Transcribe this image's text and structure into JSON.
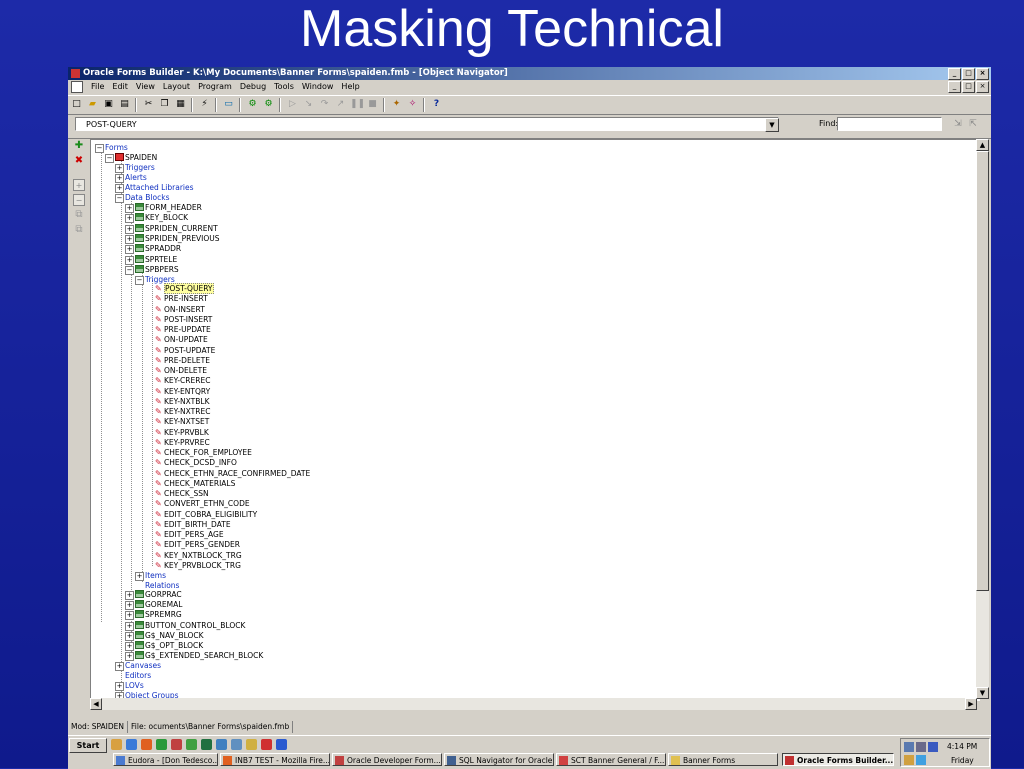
{
  "slide": {
    "title": "Masking Technical"
  },
  "window": {
    "title": "Oracle Forms Builder - K:\\My Documents\\Banner Forms\\spaiden.fmb - [Object Navigator]",
    "controls": [
      "_",
      "□",
      "×"
    ]
  },
  "menu": [
    "File",
    "Edit",
    "View",
    "Layout",
    "Program",
    "Debug",
    "Tools",
    "Window",
    "Help"
  ],
  "findbar": {
    "current": "POST-QUERY",
    "find_label": "Find:",
    "find_value": ""
  },
  "tree": {
    "forms": "Forms",
    "form": "SPAIDEN",
    "triggers": "Triggers",
    "alerts": "Alerts",
    "attached_libraries": "Attached Libraries",
    "data_blocks": "Data Blocks",
    "blocks_before": [
      "FORM_HEADER",
      "KEY_BLOCK",
      "SPRIDEN_CURRENT",
      "SPRIDEN_PREVIOUS",
      "SPRADDR",
      "SPRTELE"
    ],
    "open_block": "SPBPERS",
    "open_block_triggers": "Triggers",
    "block_triggers": [
      "POST-QUERY",
      "PRE-INSERT",
      "ON-INSERT",
      "POST-INSERT",
      "PRE-UPDATE",
      "ON-UPDATE",
      "POST-UPDATE",
      "PRE-DELETE",
      "ON-DELETE",
      "KEY-CREREC",
      "KEY-ENTQRY",
      "KEY-NXTBLK",
      "KEY-NXTREC",
      "KEY-NXTSET",
      "KEY-PRVBLK",
      "KEY-PRVREC",
      "CHECK_FOR_EMPLOYEE",
      "CHECK_DCSD_INFO",
      "CHECK_ETHN_RACE_CONFIRMED_DATE",
      "CHECK_MATERIALS",
      "CHECK_SSN",
      "CONVERT_ETHN_CODE",
      "EDIT_COBRA_ELIGIBILITY",
      "EDIT_BIRTH_DATE",
      "EDIT_PERS_AGE",
      "EDIT_PERS_GENDER",
      "KEY_NXTBLOCK_TRG",
      "KEY_PRVBLOCK_TRG"
    ],
    "items": "Items",
    "relations": "Relations",
    "blocks_after": [
      "GORPRAC",
      "GOREMAL",
      "SPREMRG",
      "BUTTON_CONTROL_BLOCK",
      "G$_NAV_BLOCK",
      "G$_OPT_BLOCK",
      "G$_EXTENDED_SEARCH_BLOCK"
    ],
    "canvases": "Canvases",
    "editors": "Editors",
    "lovs": "LOVs",
    "object_groups": "Object Groups"
  },
  "status": {
    "module": "Mod: SPAIDEN",
    "file": "File: ocuments\\Banner Forms\\spaiden.fmb"
  },
  "taskbar": {
    "start": "Start",
    "tasks": [
      "Eudora - [Don Tedesco...",
      "INB7 TEST - Mozilla Fire...",
      "Oracle Developer Form...",
      "SQL Navigator for Oracle",
      "SCT Banner General / F...",
      "Banner Forms",
      "Oracle Forms Builder..."
    ],
    "time": "4:14 PM",
    "day": "Friday"
  }
}
